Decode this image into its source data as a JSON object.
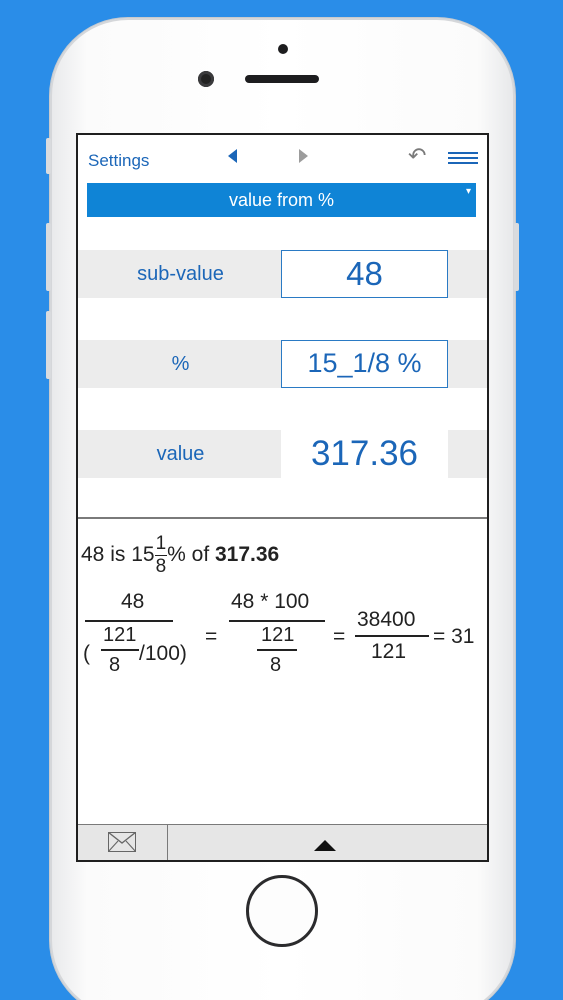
{
  "toolbar": {
    "settings_label": "Settings",
    "nav_back_icon": "triangle-left-icon",
    "nav_forward_icon": "triangle-right-icon",
    "undo_icon": "undo-icon",
    "menu_icon": "hamburger-menu-icon"
  },
  "mode_selector": {
    "value": "value from %",
    "caret": "▾"
  },
  "fields": [
    {
      "label": "sub-value",
      "value": "48"
    },
    {
      "label": "%",
      "value": "15_1/8 %"
    },
    {
      "label": "value",
      "value": "317.36"
    }
  ],
  "result": {
    "prefix": "48 is 15",
    "frac_num": "1",
    "frac_den": "8",
    "middle": "% of ",
    "answer": "317.36"
  },
  "equation": {
    "f1_num": "48",
    "f1_den_open": "(",
    "f1_den_num": "121",
    "f1_den_den": "8",
    "f1_den_close": "/100)",
    "eq1": "=",
    "f2_num": "48 * 100",
    "f2_den_num": "121",
    "f2_den_den": "8",
    "eq2": "=",
    "f3_num": "38400",
    "f3_den": "121",
    "eq3": "= 31"
  },
  "bottom_bar": {
    "mail_icon": "envelope-icon",
    "expand_icon": "triangle-up-icon"
  },
  "colors": {
    "background": "#2a8de8",
    "accent": "#1b66b8",
    "selector": "#0f84d6"
  }
}
